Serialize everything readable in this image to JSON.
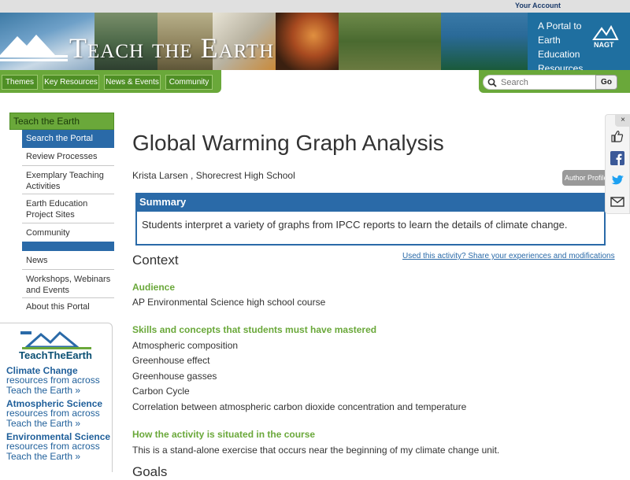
{
  "topbar": {
    "account_label": "Your Account"
  },
  "banner": {
    "title": "Teach the Earth",
    "tagline": "A Portal to Earth Education Resources",
    "nagt_logo": "NAGT"
  },
  "nav": {
    "items": [
      {
        "label": "Themes"
      },
      {
        "label": "Key Resources"
      },
      {
        "label": "News & Events"
      },
      {
        "label": "Community"
      }
    ]
  },
  "search": {
    "placeholder": "Search",
    "go_label": "Go"
  },
  "sidebar": {
    "heading": "Teach the Earth",
    "items": [
      {
        "label": "Search the Portal"
      },
      {
        "label": "Review Processes"
      },
      {
        "label": "Exemplary Teaching Activities"
      },
      {
        "label": "Earth Education Project Sites"
      },
      {
        "label": "Community"
      },
      {
        "label": "News"
      },
      {
        "label": "Workshops, Webinars and Events"
      },
      {
        "label": "About this Portal"
      }
    ]
  },
  "promo": {
    "logo_text": "TeachTheEarth",
    "links": [
      {
        "title": "Climate Change",
        "sub": "resources from across Teach the Earth »"
      },
      {
        "title": "Atmospheric Science",
        "sub": "resources from across Teach the Earth »"
      },
      {
        "title": "Environmental Science",
        "sub": "resources from across Teach the Earth »"
      }
    ]
  },
  "main": {
    "title": "Global Warming Graph Analysis",
    "author": "Krista Larsen , Shorecrest High School",
    "author_profile": "Author Profile",
    "summary": {
      "heading": "Summary",
      "text": "Students interpret a variety of graphs from IPCC reports to learn the details of climate change."
    },
    "context_heading": "Context",
    "used_link": "Used this activity? Share your experiences and modifications",
    "audience": {
      "heading": "Audience",
      "text": "AP Environmental Science high school course"
    },
    "skills": {
      "heading": "Skills and concepts that students must have mastered",
      "items": [
        "Atmospheric composition",
        "Greenhouse effect",
        "Greenhouse gasses",
        "Carbon Cycle",
        "Correlation between atmospheric carbon dioxide concentration and temperature"
      ]
    },
    "situated": {
      "heading": "How the activity is situated in the course",
      "text": "This is a stand-alone exercise that occurs near the beginning of my climate change unit."
    },
    "goals_heading": "Goals"
  },
  "share": {
    "close": "×",
    "icons": [
      "thumbs-up-icon",
      "facebook-icon",
      "twitter-icon",
      "email-icon"
    ]
  },
  "colors": {
    "brand_green": "#6aa83a",
    "brand_blue": "#2a6aa8",
    "banner_blue": "#0a4f73"
  }
}
